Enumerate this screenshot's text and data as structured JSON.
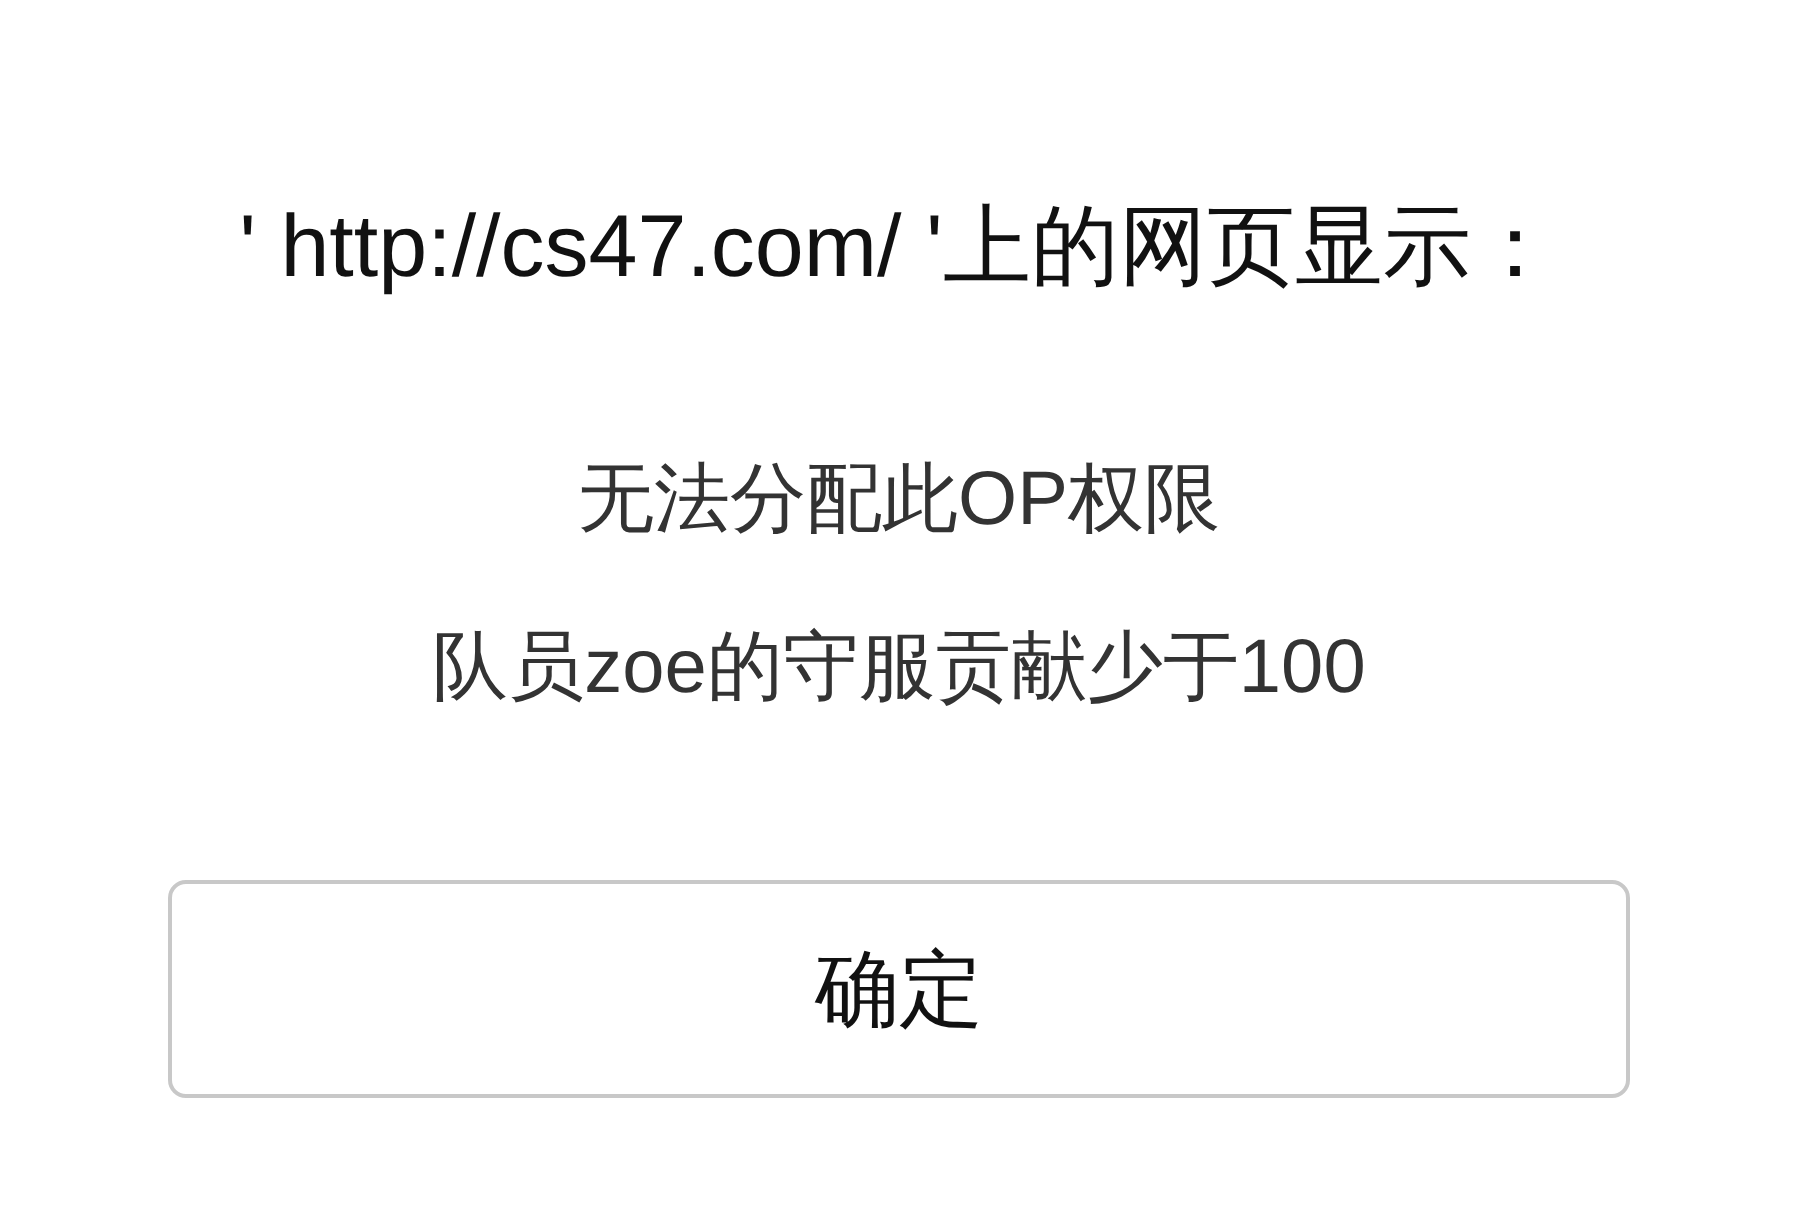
{
  "dialog": {
    "title": "' http://cs47.com/ '上的网页显示：",
    "message_lines": [
      "无法分配此OP权限",
      "队员zoe的守服贡献少于100"
    ],
    "buttons": [
      {
        "label": "确定"
      }
    ]
  }
}
